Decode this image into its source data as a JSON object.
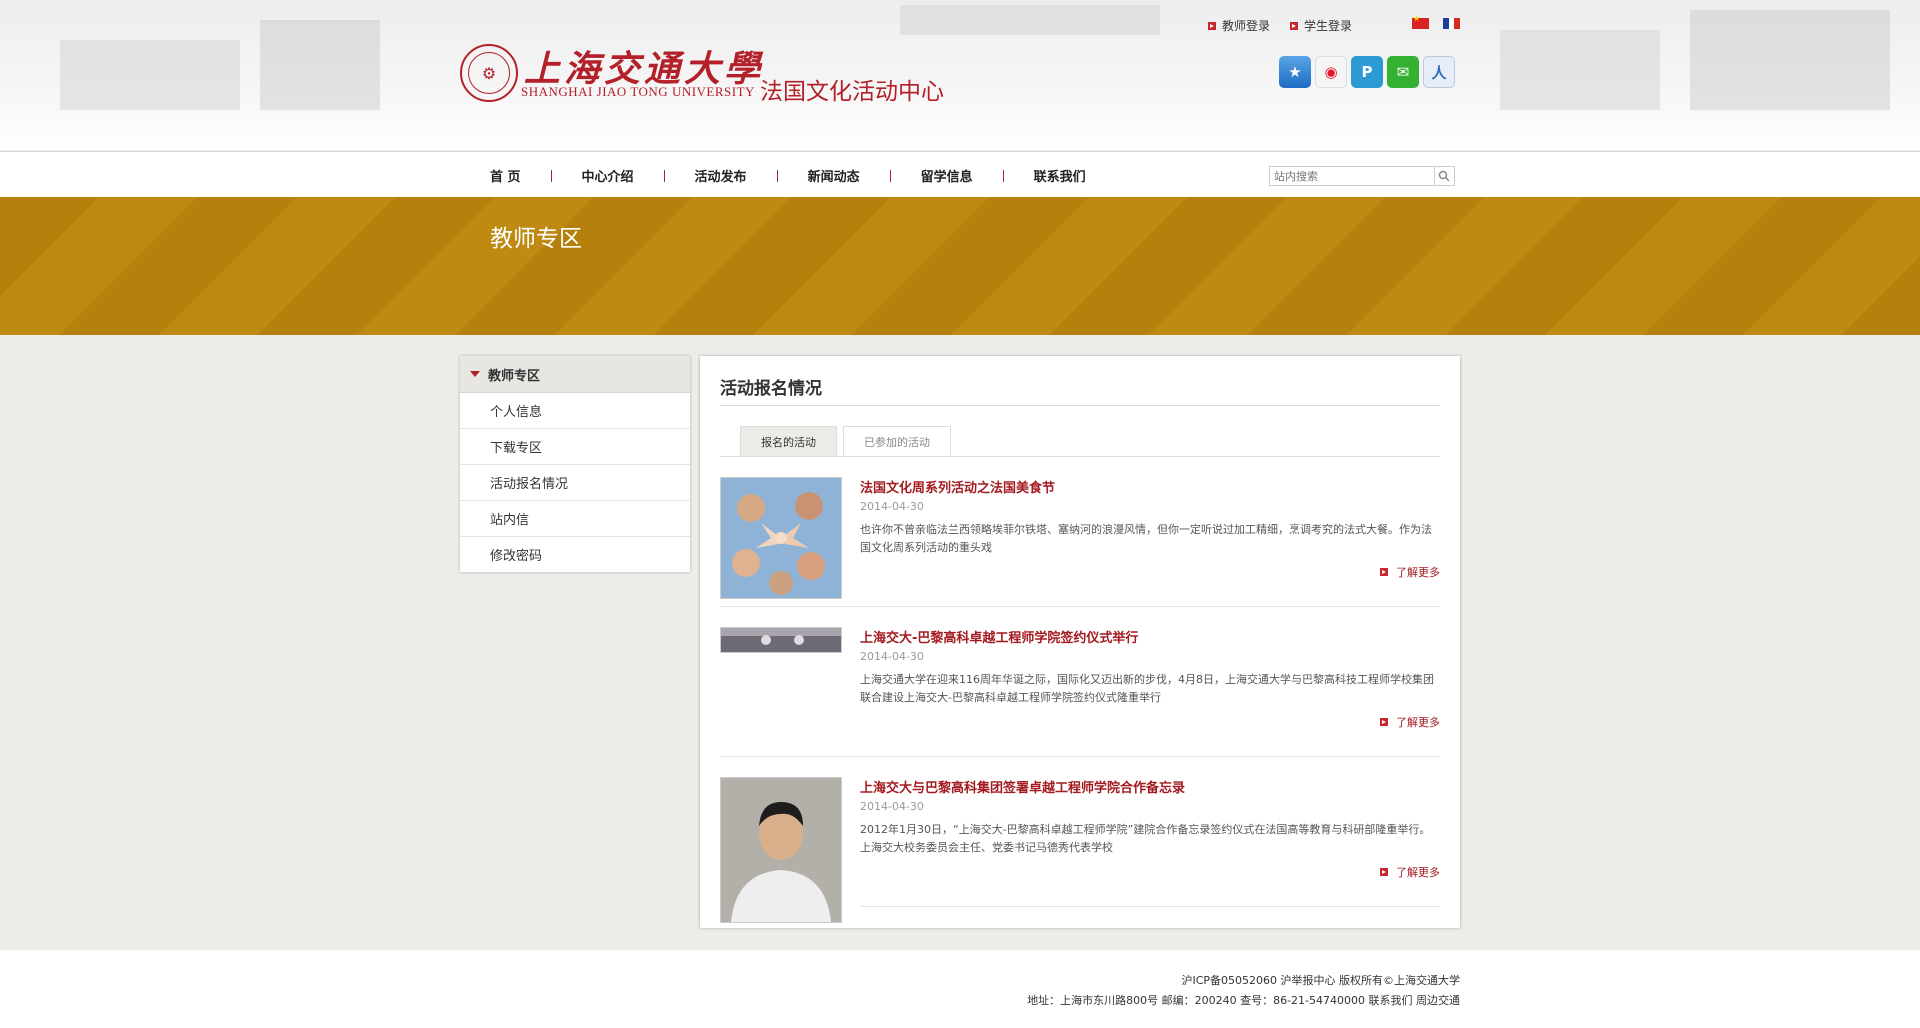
{
  "header": {
    "university_cn": "上海交通大學",
    "university_en": "SHANGHAI JIAO TONG UNIVERSITY",
    "site_title": "法国文化活动中心",
    "top_links": [
      "教师登录",
      "学生登录"
    ],
    "languages": [
      "chinese-flag",
      "french-flag"
    ],
    "socials": [
      "qzone-icon",
      "weibo-icon",
      "tencent-weibo-icon",
      "wechat-icon",
      "renren-icon"
    ]
  },
  "nav": {
    "items": [
      "首 页",
      "中心介绍",
      "活动发布",
      "新闻动态",
      "留学信息",
      "联系我们"
    ],
    "search_placeholder": "站内搜索"
  },
  "banner": {
    "title": "教师专区"
  },
  "sidebar": {
    "heading": "教师专区",
    "items": [
      "个人信息",
      "下载专区",
      "活动报名情况",
      "站内信",
      "修改密码"
    ]
  },
  "main": {
    "title": "活动报名情况",
    "tabs": [
      "报名的活动",
      "已参加的活动"
    ],
    "items": [
      {
        "title": "法国文化周系列活动之法国美食节",
        "date": "2014-04-30",
        "desc": "也许你不曾亲临法兰西领略埃菲尔铁塔、塞纳河的浪漫风情，但你一定听说过加工精细，烹调考究的法式大餐。作为法国文化周系列活动的重头戏",
        "more": "了解更多"
      },
      {
        "title": "上海交大-巴黎高科卓越工程师学院签约仪式举行",
        "date": "2014-04-30",
        "desc": "上海交通大学在迎来116周年华诞之际，国际化又迈出新的步伐，4月8日，上海交通大学与巴黎高科技工程师学校集团联合建设上海交大-巴黎高科卓越工程师学院签约仪式隆重举行",
        "more": "了解更多"
      },
      {
        "title": "上海交大与巴黎高科集团签署卓越工程师学院合作备忘录",
        "date": "2014-04-30",
        "desc": "2012年1月30日，“上海交大-巴黎高科卓越工程师学院”建院合作备忘录签约仪式在法国高等教育与科研部隆重举行。上海交大校务委员会主任、党委书记马德秀代表学校",
        "more": "了解更多"
      }
    ]
  },
  "footer": {
    "line1": "沪ICP备05052060 沪举报中心 版权所有©上海交通大学",
    "line2": "地址：上海市东川路800号 邮编：200240 查号：86-21-54740000 联系我们 周边交通"
  },
  "colors": {
    "brand_red": "#b3202a",
    "banner_gold": "#b5800c"
  }
}
